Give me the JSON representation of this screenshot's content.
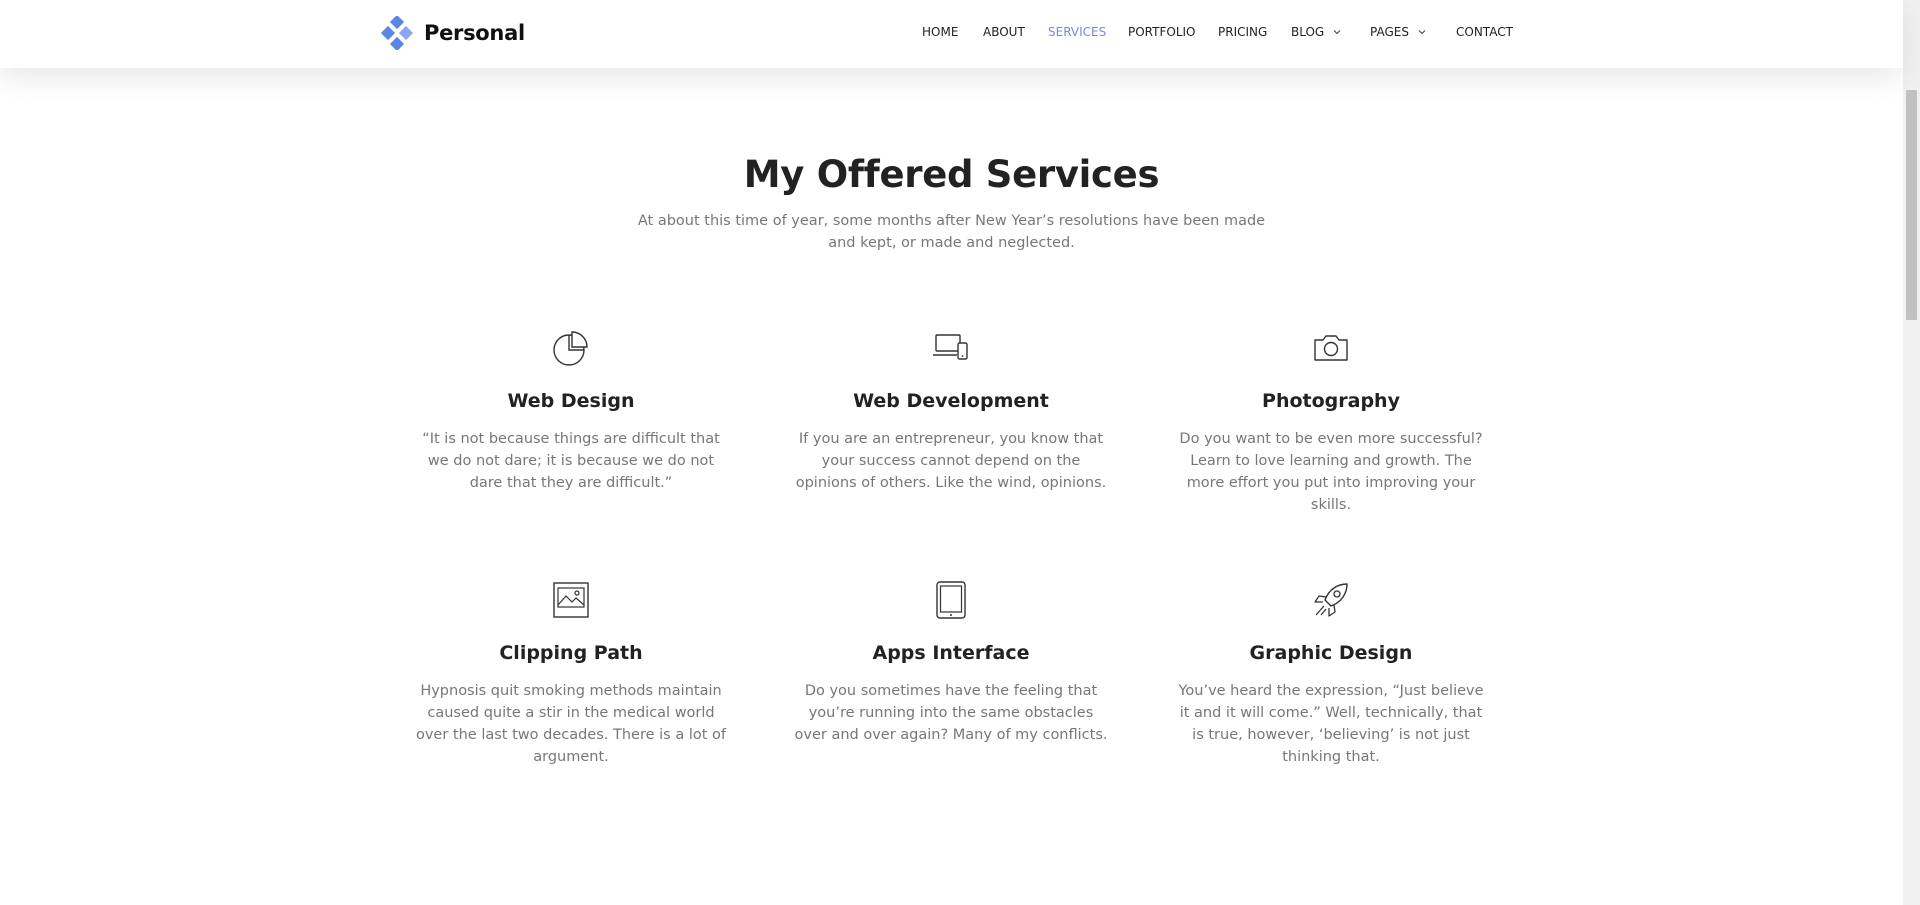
{
  "brand": {
    "name": "Personal",
    "accent": "#7b86e8",
    "logo_icon": "diamond-cluster-icon"
  },
  "nav": {
    "items": [
      {
        "label": "HOME",
        "active": false
      },
      {
        "label": "ABOUT",
        "active": false
      },
      {
        "label": "SERVICES",
        "active": true
      },
      {
        "label": "PORTFOLIO",
        "active": false
      },
      {
        "label": "PRICING",
        "active": false
      },
      {
        "label": "BLOG",
        "active": false,
        "dropdown": true
      },
      {
        "label": "PAGES",
        "active": false,
        "dropdown": true
      },
      {
        "label": "CONTACT",
        "active": false
      }
    ]
  },
  "section": {
    "title": "My Offered Services",
    "subtitle": "At about this time of year, some months after New Year’s resolutions have been made and kept, or made and neglected."
  },
  "services": [
    {
      "icon": "pie-chart-icon",
      "title": "Web Design",
      "description": "“It is not because things are difficult that we do not dare; it is because we do not dare that they are difficult.”"
    },
    {
      "icon": "devices-icon",
      "title": "Web Development",
      "description": "If you are an entrepreneur, you know that your success cannot depend on the opinions of others. Like the wind, opinions."
    },
    {
      "icon": "camera-icon",
      "title": "Photography",
      "description": "Do you want to be even more successful? Learn to love learning and growth. The more effort you put into improving your skills."
    },
    {
      "icon": "image-icon",
      "title": "Clipping Path",
      "description": "Hypnosis quit smoking methods maintain caused quite a stir in the medical world over the last two decades. There is a lot of argument."
    },
    {
      "icon": "tablet-icon",
      "title": "Apps Interface",
      "description": "Do you sometimes have the feeling that you’re running into the same obstacles over and over again? Many of my conflicts."
    },
    {
      "icon": "rocket-icon",
      "title": "Graphic Design",
      "description": "You’ve heard the expression, “Just believe it and it will come.” Well, technically, that is true, however, ‘believing’ is not just thinking that."
    }
  ]
}
